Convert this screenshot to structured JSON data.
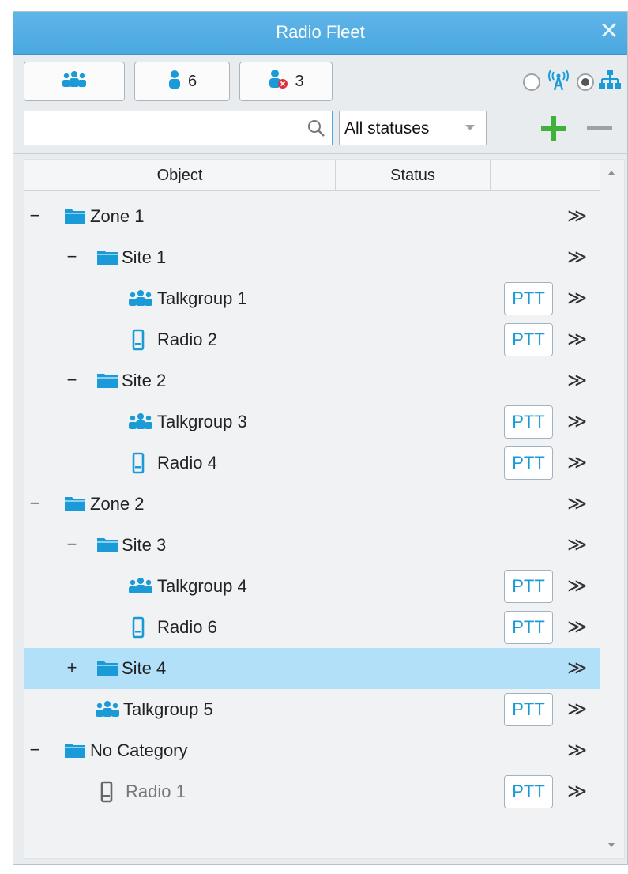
{
  "window": {
    "title": "Radio Fleet",
    "close_glyph": "✕"
  },
  "toolbar": {
    "groups_button": {
      "icon": "talkgroup-icon"
    },
    "online_button": {
      "icon": "user-icon",
      "count": "6"
    },
    "offline_button": {
      "icon": "user-offline-icon",
      "count": "3"
    },
    "view_modes": [
      {
        "icon": "radio-tower-icon",
        "selected": false
      },
      {
        "icon": "hierarchy-icon",
        "selected": true
      }
    ]
  },
  "filter": {
    "search_value": "",
    "search_placeholder": "",
    "status_selected": "All statuses",
    "add_icon": "plus-icon",
    "remove_icon": "minus-icon"
  },
  "columns": [
    "Object",
    "Status",
    ""
  ],
  "rows": [
    {
      "label": "Zone 1",
      "type": "folder",
      "expander": "−",
      "ptt": "",
      "more": "≫",
      "selected": false
    },
    {
      "label": "Site 1",
      "type": "folder",
      "expander": "−",
      "ptt": "",
      "more": "≫",
      "selected": false
    },
    {
      "label": "Talkgroup 1",
      "type": "talkgroup",
      "expander": "",
      "ptt": "PTT",
      "more": "≫",
      "selected": false
    },
    {
      "label": "Radio 2",
      "type": "radio",
      "expander": "",
      "ptt": "PTT",
      "more": "≫",
      "selected": false
    },
    {
      "label": "Site 2",
      "type": "folder",
      "expander": "−",
      "ptt": "",
      "more": "≫",
      "selected": false
    },
    {
      "label": "Talkgroup 3",
      "type": "talkgroup",
      "expander": "",
      "ptt": "PTT",
      "more": "≫",
      "selected": false
    },
    {
      "label": "Radio 4",
      "type": "radio",
      "expander": "",
      "ptt": "PTT",
      "more": "≫",
      "selected": false
    },
    {
      "label": "Zone 2",
      "type": "folder",
      "expander": "−",
      "ptt": "",
      "more": "≫",
      "selected": false
    },
    {
      "label": "Site 3",
      "type": "folder",
      "expander": "−",
      "ptt": "",
      "more": "≫",
      "selected": false
    },
    {
      "label": "Talkgroup 4",
      "type": "talkgroup",
      "expander": "",
      "ptt": "PTT",
      "more": "≫",
      "selected": false
    },
    {
      "label": "Radio 6",
      "type": "radio",
      "expander": "",
      "ptt": "PTT",
      "more": "≫",
      "selected": false
    },
    {
      "label": "Site 4",
      "type": "folder",
      "expander": "+",
      "ptt": "",
      "more": "≫",
      "selected": true
    },
    {
      "label": "Talkgroup 5",
      "type": "talkgroup",
      "expander": "",
      "ptt": "PTT",
      "more": "≫",
      "selected": false
    },
    {
      "label": "No Category",
      "type": "folder",
      "expander": "−",
      "ptt": "",
      "more": "≫",
      "selected": false
    },
    {
      "label": "Radio 1",
      "type": "radio-offline",
      "expander": "",
      "ptt": "PTT",
      "more": "≫",
      "selected": false
    }
  ],
  "colors": {
    "accent": "#4aa8e0",
    "icon_blue": "#1a9ad6",
    "selection": "#b3e0f9",
    "add_green": "#3fb23a"
  }
}
